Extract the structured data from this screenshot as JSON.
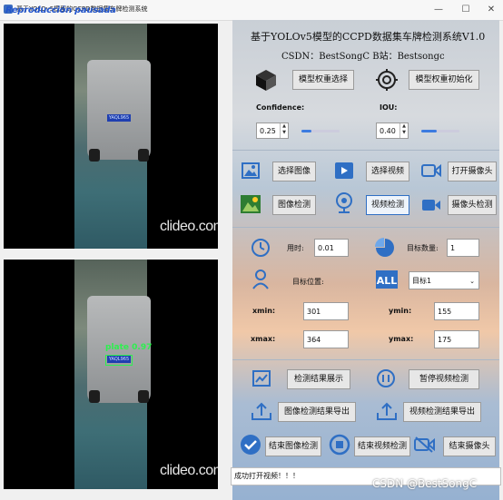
{
  "window": {
    "title": "基于YOLOv5模型的CCPD数据集车牌检测系统",
    "overlay_text": "Reproducción pausada",
    "min_btn": "—",
    "max_btn": "☐",
    "close_btn": "✕"
  },
  "video": {
    "plate_text": "YAQL965",
    "detect_label": "plate 0.97",
    "watermark": "clideo.com"
  },
  "header": {
    "title": "基于YOLOv5模型的CCPD数据集车牌检测系统V1.0",
    "subtitle": "CSDN：BestSongC  B站：Bestsongc"
  },
  "weights": {
    "select_label": "模型权重选择",
    "init_label": "模型权重初始化"
  },
  "params": {
    "confidence_label": "Confidence:",
    "confidence_value": "0.25",
    "confidence_level": 0.25,
    "iou_label": "IOU:",
    "iou_value": "0.40",
    "iou_level": 0.4
  },
  "source_buttons": {
    "select_image": "选择图像",
    "select_video": "选择视频",
    "open_camera": "打开摄像头",
    "image_detect": "图像检测",
    "video_detect": "视频检测",
    "camera_detect": "摄像头检测"
  },
  "stats": {
    "time_label": "用时:",
    "time_value": "0.01",
    "count_label": "目标数量:",
    "count_value": "1",
    "position_label": "目标位置:",
    "target_select": "目标1",
    "xmin_label": "xmin:",
    "xmin_value": "301",
    "ymin_label": "ymin:",
    "ymin_value": "155",
    "xmax_label": "xmax:",
    "xmax_value": "364",
    "ymax_label": "ymax:",
    "ymax_value": "175"
  },
  "actions": {
    "show_results": "检测结果展示",
    "pause_video": "暂停视频检测",
    "export_image": "图像检测结果导出",
    "export_video": "视频检测结果导出",
    "end_image": "结束图像检测",
    "end_video": "结束视频检测",
    "end_camera": "结束摄像头"
  },
  "status": {
    "message": "成功打开视频！！！"
  },
  "footer": {
    "watermark": "CSDN @BestSongC"
  },
  "colors": {
    "accent": "#2f6fc4",
    "icon_blue": "#3a86d8",
    "detect_green": "#2df04f"
  }
}
